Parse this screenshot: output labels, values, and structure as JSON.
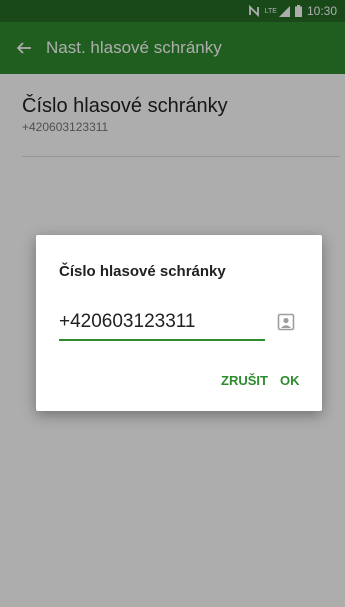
{
  "status_bar": {
    "time": "10:30",
    "network_label": "LTE"
  },
  "app_bar": {
    "title": "Nast. hlasové schránky"
  },
  "preference": {
    "title": "Číslo hlasové schránky",
    "summary": "+420603123311"
  },
  "dialog": {
    "title": "Číslo hlasové schránky",
    "input_value": "+420603123311",
    "cancel_label": "ZRUŠIT",
    "ok_label": "OK"
  },
  "colors": {
    "accent": "#2e8b2e",
    "status_bar": "#256c25",
    "app_bar": "#2e8b2e"
  },
  "icons": {
    "back": "arrow-left-icon",
    "nfc": "nfc-icon",
    "network": "lte-signal-icon",
    "battery": "battery-icon",
    "contact_picker": "contact-picker-icon"
  }
}
